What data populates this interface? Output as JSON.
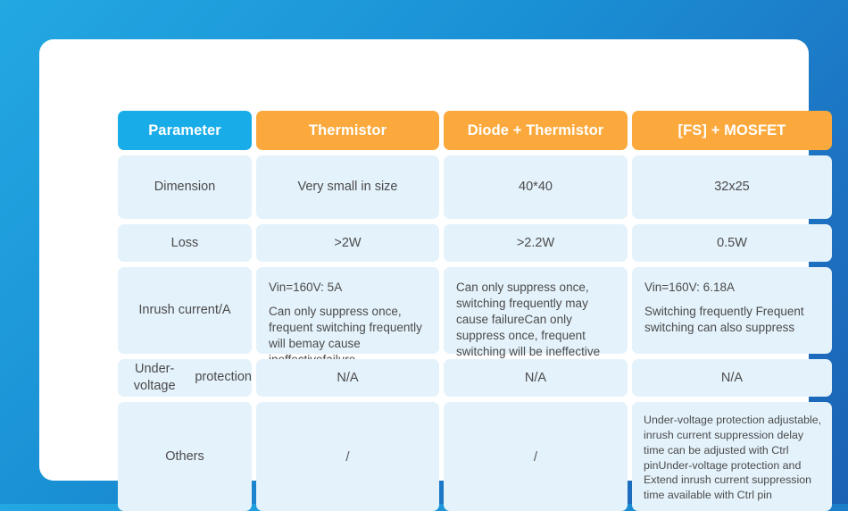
{
  "theme": {
    "bg_gradient_start": "#23a8e2",
    "bg_gradient_end": "#1c62b4",
    "card_bg": "#ffffff",
    "header_param_bg": "#18ade8",
    "header_product_bg": "#fba93c",
    "cell_bg": "#e4f2fb",
    "text_color": "#4b4b4b"
  },
  "table": {
    "headers": {
      "parameter": "Parameter",
      "col2": "Thermistor",
      "col3": "Diode + Thermistor",
      "col4": "[FS] + MOSFET"
    },
    "rows": {
      "dimension": {
        "label": "Dimension",
        "col2": "Very small in size",
        "col3": "40*40",
        "col4": "32x25"
      },
      "loss": {
        "label": "Loss",
        "col2": ">2W",
        "col3": ">2.2W",
        "col4": "0.5W"
      },
      "inrush": {
        "label": "Inrush current/A",
        "col2_lead": "Vin=160V: 5A",
        "col2_body": "Can only suppress once, frequent switching frequently will bemay cause ineffectivefailure",
        "col3_body": "Can only suppress once, switching frequently may cause failureCan only suppress once, frequent switching will be ineffective",
        "col4_lead": "Vin=160V: 6.18A",
        "col4_body": "Switching frequently Frequent switching can also suppress"
      },
      "under_voltage": {
        "label_line1": "Under-voltage",
        "label_line2": "protection",
        "col2": "N/A",
        "col3": "N/A",
        "col4": "N/A"
      },
      "others": {
        "label": "Others",
        "col2": "/",
        "col3": "/",
        "col4": "Under-voltage protection adjustable, inrush current suppression delay time can be adjusted with Ctrl pinUnder-voltage protection and Extend inrush current suppression time available with Ctrl pin"
      }
    }
  }
}
